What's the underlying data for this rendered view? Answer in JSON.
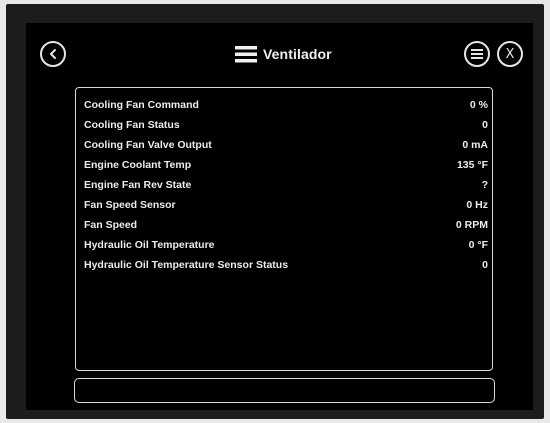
{
  "header": {
    "title": "Ventilador",
    "back_icon": "back-arrow-icon",
    "menu_icon": "list-icon",
    "close_label": "X"
  },
  "parameters": [
    {
      "name": "Cooling Fan Command",
      "value": "0 %"
    },
    {
      "name": "Cooling Fan Status",
      "value": "0"
    },
    {
      "name": "Cooling Fan Valve Output",
      "value": "0 mA"
    },
    {
      "name": "Engine Coolant Temp",
      "value": "135 °F"
    },
    {
      "name": "Engine Fan Rev State",
      "value": "?"
    },
    {
      "name": "Fan Speed Sensor",
      "value": "0 Hz"
    },
    {
      "name": "Fan Speed",
      "value": "0 RPM"
    },
    {
      "name": "Hydraulic Oil Temperature",
      "value": "0 °F"
    },
    {
      "name": "Hydraulic Oil Temperature Sensor Status",
      "value": "0"
    }
  ],
  "colors": {
    "background": "#000000",
    "bezel": "#1c1c1c",
    "foreground": "#ececec"
  }
}
